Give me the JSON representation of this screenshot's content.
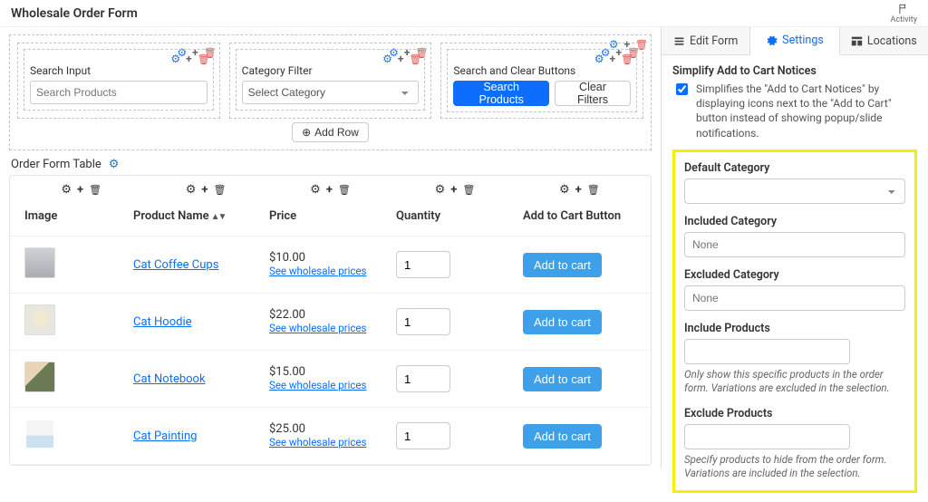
{
  "header": {
    "title": "Wholesale Order Form",
    "activity_label": "Activity"
  },
  "builder": {
    "blocks": {
      "search": {
        "label": "Search Input",
        "placeholder": "Search Products"
      },
      "category": {
        "label": "Category Filter",
        "placeholder": "Select Category"
      },
      "buttons": {
        "label": "Search and Clear Buttons",
        "search_btn": "Search Products",
        "clear_btn": "Clear Filters"
      }
    },
    "add_row_label": "Add Row"
  },
  "table_section": {
    "title": "Order Form Table"
  },
  "table": {
    "headers": {
      "image": "Image",
      "name": "Product Name",
      "price": "Price",
      "qty": "Quantity",
      "cart": "Add to Cart Button"
    },
    "see_prices": "See wholesale prices",
    "add_to_cart": "Add to cart",
    "rows": [
      {
        "name": "Cat Coffee Cups",
        "price": "$10.00",
        "qty": "1"
      },
      {
        "name": "Cat Hoodie",
        "price": "$22.00",
        "qty": "1"
      },
      {
        "name": "Cat Notebook",
        "price": "$15.00",
        "qty": "1"
      },
      {
        "name": "Cat Painting",
        "price": "$25.00",
        "qty": "1"
      }
    ]
  },
  "sidebar": {
    "tabs": {
      "edit": "Edit Form",
      "settings": "Settings",
      "locations": "Locations"
    },
    "simplify": {
      "title": "Simplify Add to Cart Notices",
      "desc": "Simplifies the \"Add to Cart Notices\" by displaying icons next to the \"Add to Cart\" button instead of showing popup/slide notifications."
    },
    "fields": {
      "default_category": {
        "label": "Default Category",
        "value": ""
      },
      "included_category": {
        "label": "Included Category",
        "placeholder": "None"
      },
      "excluded_category": {
        "label": "Excluded Category",
        "placeholder": "None"
      },
      "include_products": {
        "label": "Include Products",
        "hint": "Only show this specific products in the order form. Variations are excluded in the selection."
      },
      "exclude_products": {
        "label": "Exclude Products",
        "hint": "Specify products to hide from the order form. Variations are included in the selection."
      }
    }
  }
}
